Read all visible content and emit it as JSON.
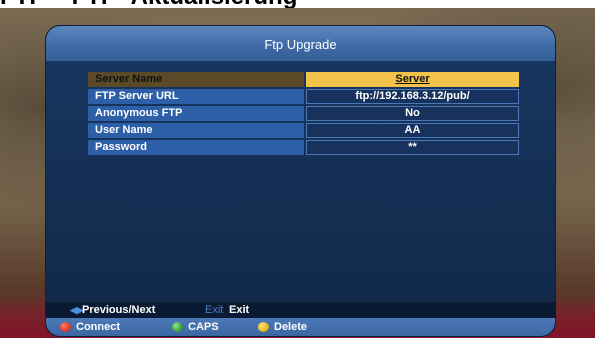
{
  "page_heading": "FTP – FTP- Aktualisierung",
  "dialog": {
    "title": "Ftp Upgrade"
  },
  "rows": [
    {
      "label": "Server Name",
      "value": "Server"
    },
    {
      "label": "FTP Server URL",
      "value": "ftp://192.168.3.12/pub/"
    },
    {
      "label": "Anonymous FTP",
      "value": "No"
    },
    {
      "label": "User Name",
      "value": "AA"
    },
    {
      "label": "Password",
      "value": "**"
    }
  ],
  "nav": {
    "prev_next": "Previous/Next",
    "exit_key": "Exit",
    "exit_label": "Exit"
  },
  "footer": {
    "connect": "Connect",
    "caps": "CAPS",
    "delete": "Delete"
  },
  "colors": {
    "selected_value_bg": "#f3c24a",
    "red_key": "#e03a2a",
    "green_key": "#3aa63a",
    "yellow_key": "#e8b820"
  }
}
